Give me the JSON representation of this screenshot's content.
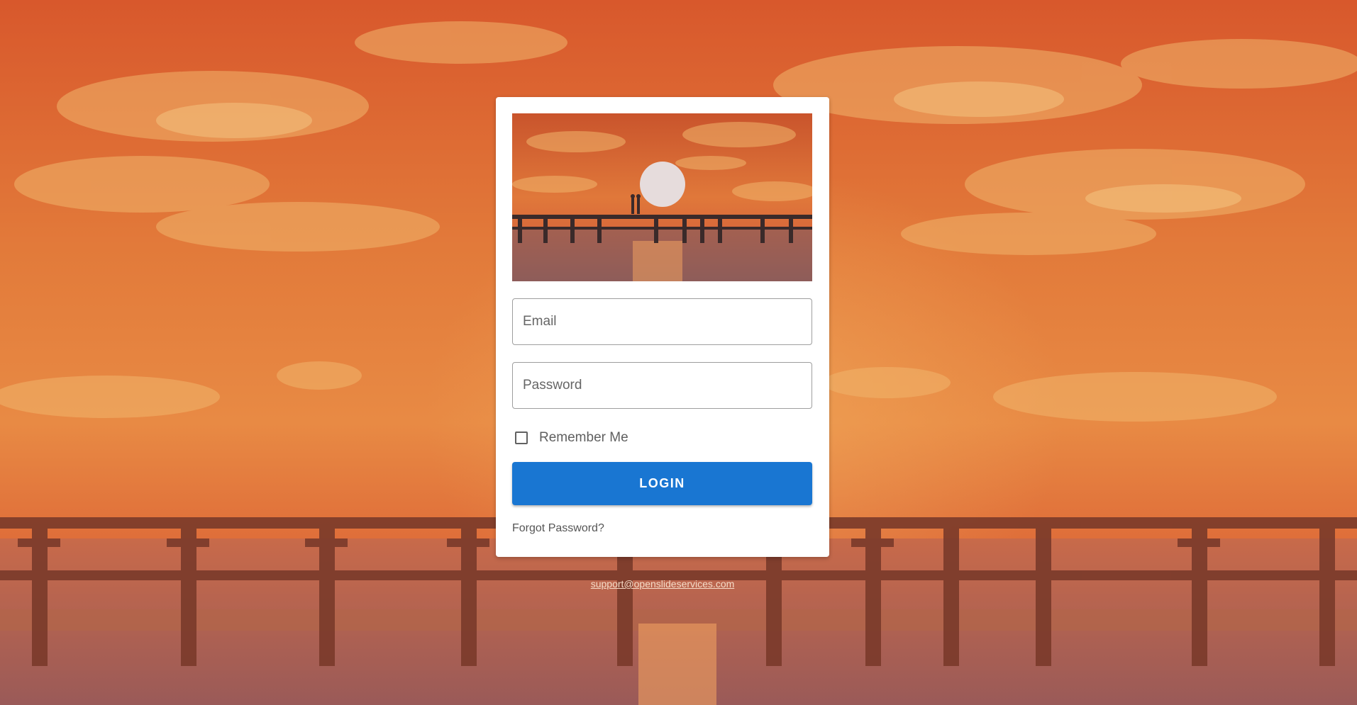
{
  "login_form": {
    "email_placeholder": "Email",
    "password_placeholder": "Password",
    "remember_label": "Remember Me",
    "remember_checked": false,
    "login_label": "LOGIN",
    "forgot_label": "Forgot Password?"
  },
  "footer": {
    "support_email": "support@openslideservices.com"
  },
  "colors": {
    "accent": "#1976d2",
    "sky": "#e07a3c",
    "card": "#ffffff"
  },
  "icons": {
    "checkbox": "checkbox-unchecked-icon"
  }
}
